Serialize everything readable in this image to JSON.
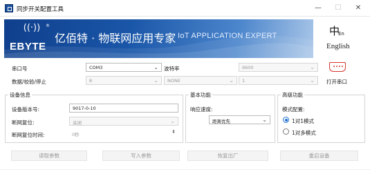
{
  "window": {
    "title": "同步开关配置工具",
    "minimize": "—",
    "maximize": "☐",
    "close": "✕"
  },
  "banner": {
    "logo_mark": "((·))",
    "logo_text": "EBYTE",
    "logo_reg": "®",
    "slogan_cn": "亿佰特 · 物联网应用专家",
    "slogan_en": "IoT APPLICATION EXPERT"
  },
  "language": {
    "glyph": "中",
    "glyph_sub": "En",
    "label": "English"
  },
  "serial": {
    "port_label": "串口号",
    "port_value": "COM3",
    "baud_label": "波特率",
    "baud_value": "9600",
    "params_label": "数据/校验/停止",
    "data_bits": "8",
    "parity": "NONE",
    "stop_bits": "1",
    "open_button": "打开串口",
    "icon": "serial-port-icon"
  },
  "device_info": {
    "title": "设备信息",
    "version_label": "设备版本号:",
    "version_value": "9017-0-10",
    "reset_label": "断网复位:",
    "reset_value": "关闭",
    "reset_time_label": "断网复位时间:",
    "reset_time_value": "0秒"
  },
  "basic": {
    "title": "基本功能",
    "response_label": "响应速度:",
    "response_value": "距离优先"
  },
  "advanced": {
    "title": "高级功能",
    "mode_label": "模式配置:",
    "mode_options": [
      "1对1模式",
      "1对多模式"
    ],
    "mode_selected": "1对1模式"
  },
  "actions": {
    "read": "读取参数",
    "write": "写入参数",
    "restore": "恢复出厂",
    "restart": "重启设备"
  },
  "colors": {
    "banner_dark": "#0f3f8c",
    "banner_light": "#a9c6e8",
    "serial_icon": "#d8342a",
    "radio_accent": "#1f6fd1"
  }
}
